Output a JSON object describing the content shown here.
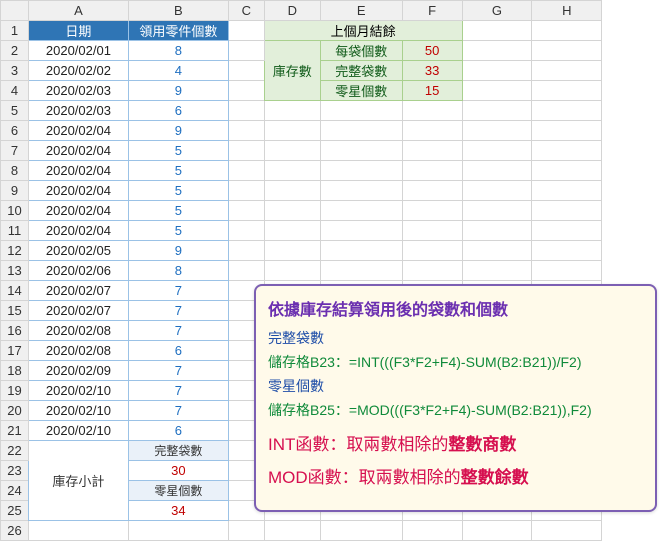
{
  "columns": [
    "A",
    "B",
    "C",
    "D",
    "E",
    "F",
    "G",
    "H"
  ],
  "header": {
    "A": "日期",
    "B": "領用零件個數"
  },
  "rows": [
    {
      "n": 1
    },
    {
      "n": 2,
      "A": "2020/02/01",
      "B": "8"
    },
    {
      "n": 3,
      "A": "2020/02/02",
      "B": "4"
    },
    {
      "n": 4,
      "A": "2020/02/03",
      "B": "9"
    },
    {
      "n": 5,
      "A": "2020/02/03",
      "B": "6"
    },
    {
      "n": 6,
      "A": "2020/02/04",
      "B": "9"
    },
    {
      "n": 7,
      "A": "2020/02/04",
      "B": "5"
    },
    {
      "n": 8,
      "A": "2020/02/04",
      "B": "5"
    },
    {
      "n": 9,
      "A": "2020/02/04",
      "B": "5"
    },
    {
      "n": 10,
      "A": "2020/02/04",
      "B": "5"
    },
    {
      "n": 11,
      "A": "2020/02/04",
      "B": "5"
    },
    {
      "n": 12,
      "A": "2020/02/05",
      "B": "9"
    },
    {
      "n": 13,
      "A": "2020/02/06",
      "B": "8"
    },
    {
      "n": 14,
      "A": "2020/02/07",
      "B": "7"
    },
    {
      "n": 15,
      "A": "2020/02/07",
      "B": "7"
    },
    {
      "n": 16,
      "A": "2020/02/08",
      "B": "7"
    },
    {
      "n": 17,
      "A": "2020/02/08",
      "B": "6"
    },
    {
      "n": 18,
      "A": "2020/02/09",
      "B": "7"
    },
    {
      "n": 19,
      "A": "2020/02/10",
      "B": "7"
    },
    {
      "n": 20,
      "A": "2020/02/10",
      "B": "7"
    },
    {
      "n": 21,
      "A": "2020/02/10",
      "B": "6"
    },
    {
      "n": 22
    },
    {
      "n": 23
    },
    {
      "n": 24
    },
    {
      "n": 25
    },
    {
      "n": 26
    }
  ],
  "summary": {
    "stock_label": "庫存小計",
    "full_bags_label": "完整袋數",
    "full_bags_value": "30",
    "loose_label": "零星個數",
    "loose_value": "34"
  },
  "topright": {
    "title": "上個月結餘",
    "stock_label": "庫存數",
    "per_bag_label": "每袋個數",
    "per_bag_value": "50",
    "full_bags_label": "完整袋數",
    "full_bags_value": "33",
    "loose_label": "零星個數",
    "loose_value": "15"
  },
  "note": {
    "title": "依據庫存結算領用後的袋數和個數",
    "sub1": "完整袋數",
    "formula1": "儲存格B23：=INT(((F3*F2+F4)-SUM(B2:B21))/F2)",
    "sub2": "零星個數",
    "formula2": "儲存格B25：=MOD(((F3*F2+F4)-SUM(B2:B21)),F2)",
    "int_prefix": "INT函數：取兩數相除的",
    "int_bold": "整數商數",
    "mod_prefix": "MOD函數：取兩數相除的",
    "mod_bold": "整數餘數"
  }
}
